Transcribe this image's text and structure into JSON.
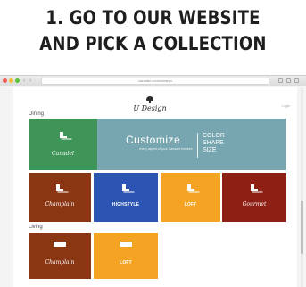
{
  "headline": {
    "line1": "1. GO TO OUR WEBSITE",
    "line2": "AND PICK A COLLECTION"
  },
  "browser": {
    "url": "canadel.com/udesign",
    "back_glyph": "‹",
    "forward_glyph": "›",
    "icons": [
      "back-icon",
      "forward-icon",
      "share-icon",
      "new-tab-icon"
    ]
  },
  "site": {
    "logo_text": "U Design",
    "login_label": "Login",
    "sections": {
      "dining": {
        "label": "Dining",
        "tiles": [
          {
            "name": "Canadel",
            "color": "#3f9557",
            "icon": "chair-icon"
          },
          {
            "name": "Champlain",
            "color": "#8a3612",
            "icon": "chair-icon"
          },
          {
            "name": "HIGHSTYLE",
            "color": "#2b54b3",
            "icon": "chair-icon"
          },
          {
            "name": "LOFT",
            "color": "#f4a422",
            "icon": "chair-icon"
          },
          {
            "name": "Gourmet",
            "color": "#8e1f14",
            "icon": "chair-icon"
          }
        ],
        "customize": {
          "title": "Customize",
          "subtitle": "every aspect of your Canadel furniture",
          "options": [
            "COLOR",
            "SHAPE",
            "SIZE"
          ],
          "color": "#78a6b0"
        }
      },
      "living": {
        "label": "Living",
        "tiles": [
          {
            "name": "Champlain",
            "color": "#8a3612",
            "icon": "sofa-icon"
          },
          {
            "name": "LOFT",
            "color": "#f4a422",
            "icon": "sofa-icon"
          }
        ]
      }
    }
  }
}
